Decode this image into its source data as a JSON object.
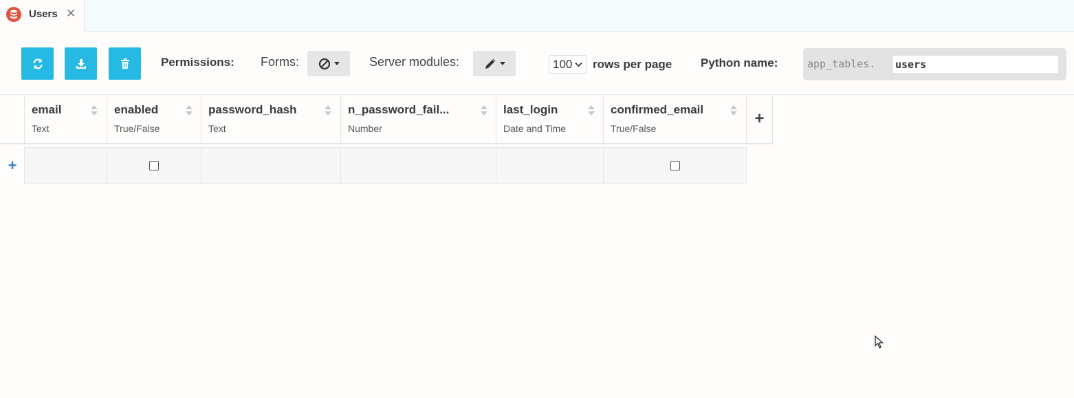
{
  "tab": {
    "label": "Users",
    "close": "✕"
  },
  "toolbar": {
    "permissions_label": "Permissions:",
    "forms_label": "Forms:",
    "server_modules_label": "Server modules:",
    "rows_per_page_value": "100",
    "rows_per_page_label": "rows per page",
    "python_name_label": "Python name:",
    "python_prefix": "app_tables.",
    "python_name_value": "users"
  },
  "columns": [
    {
      "name": "email",
      "type": "Text"
    },
    {
      "name": "enabled",
      "type": "True/False"
    },
    {
      "name": "password_hash",
      "type": "Text"
    },
    {
      "name": "n_password_fail...",
      "type": "Number"
    },
    {
      "name": "last_login",
      "type": "Date and Time"
    },
    {
      "name": "confirmed_email",
      "type": "True/False"
    }
  ],
  "add_column": "+",
  "add_row": "+",
  "colors": {
    "accent": "#26b9e4",
    "tab_icon": "#e3533d",
    "add_row": "#3b82c4"
  }
}
